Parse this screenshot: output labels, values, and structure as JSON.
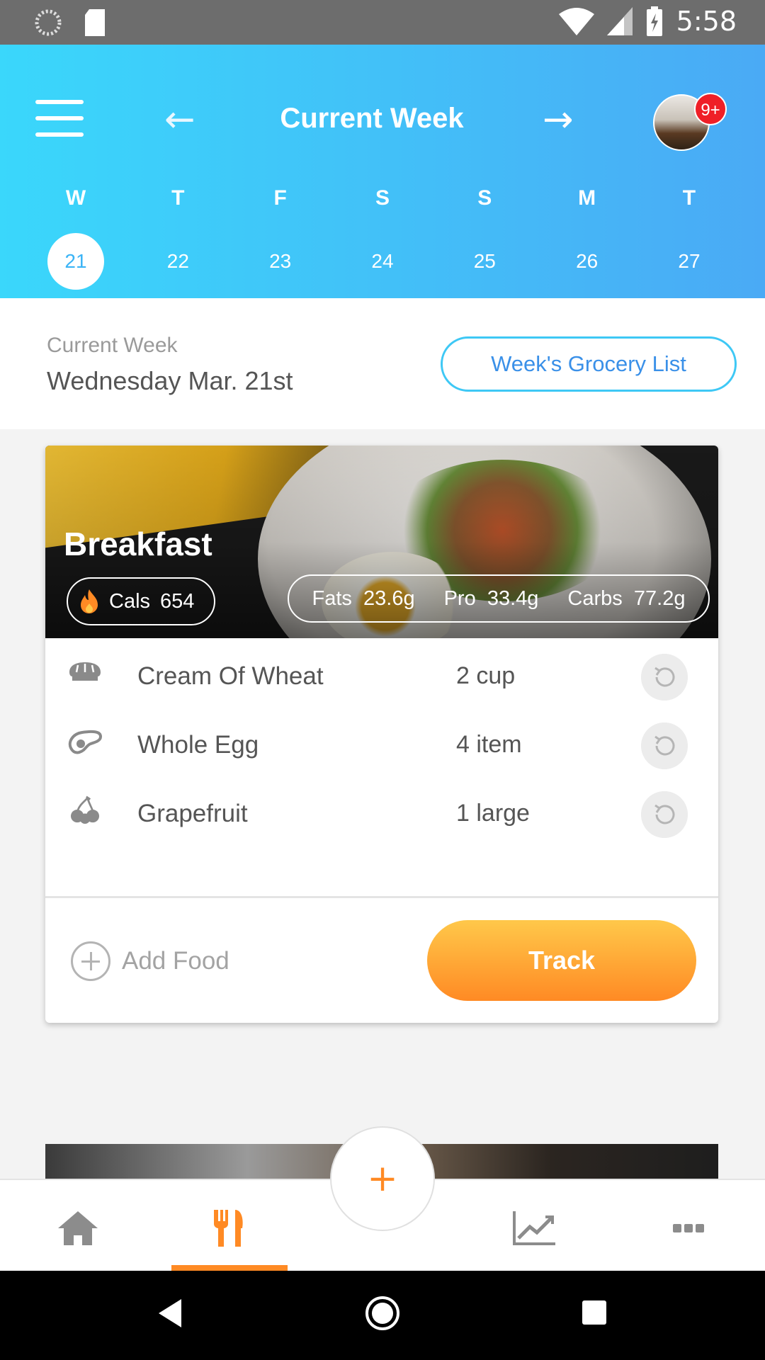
{
  "status_bar": {
    "time": "5:58"
  },
  "header": {
    "title": "Current Week",
    "notification_badge": "9+",
    "days": [
      {
        "letter": "W",
        "date": "21",
        "selected": true
      },
      {
        "letter": "T",
        "date": "22"
      },
      {
        "letter": "F",
        "date": "23"
      },
      {
        "letter": "S",
        "date": "24"
      },
      {
        "letter": "S",
        "date": "25"
      },
      {
        "letter": "M",
        "date": "26"
      },
      {
        "letter": "T",
        "date": "27"
      }
    ]
  },
  "info": {
    "label": "Current Week",
    "date": "Wednesday Mar. 21st",
    "grocery_button": "Week's Grocery List"
  },
  "meal": {
    "title": "Breakfast",
    "cals_label": "Cals",
    "cals_value": "654",
    "fats_label": "Fats",
    "fats_value": "23.6g",
    "pro_label": "Pro",
    "pro_value": "33.4g",
    "carbs_label": "Carbs",
    "carbs_value": "77.2g",
    "foods": [
      {
        "name": "Cream Of Wheat",
        "qty": "2 cup",
        "icon": "bread-icon"
      },
      {
        "name": "Whole Egg",
        "qty": "4 item",
        "icon": "steak-icon"
      },
      {
        "name": "Grapefruit",
        "qty": "1 large",
        "icon": "cherry-icon"
      }
    ],
    "add_food": "Add Food",
    "track_button": "Track"
  },
  "fab_label": "+",
  "colors": {
    "accent": "#ff8a24",
    "header_start": "#3ad7fb",
    "header_end": "#4aaaf5",
    "grocery_border": "#3ec8f5"
  }
}
